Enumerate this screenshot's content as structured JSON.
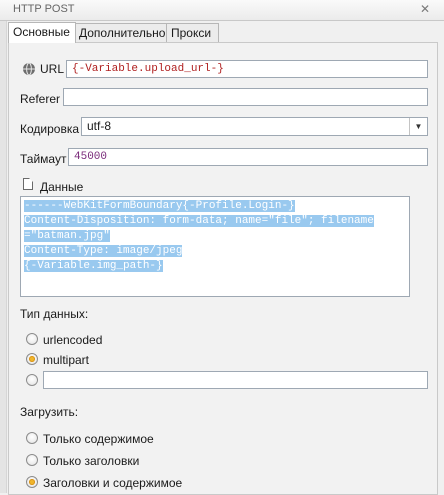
{
  "window": {
    "title": "HTTP POST"
  },
  "tabs": [
    {
      "label": "Основные",
      "active": true
    },
    {
      "label": "Дополнительно",
      "active": false
    },
    {
      "label": "Прокси",
      "active": false
    }
  ],
  "fields": {
    "url": {
      "label": "URL",
      "value": "{-Variable.upload_url-}"
    },
    "referer": {
      "label": "Referer",
      "value": ""
    },
    "encoding": {
      "label": "Кодировка",
      "value": "utf-8"
    },
    "timeout": {
      "label": "Таймаут",
      "value": "45000"
    }
  },
  "data_section": {
    "label": "Данные",
    "lines": [
      "------WebKitFormBoundary{-Profile.Login-}",
      "Content-Disposition: form-data; name=\"file\"; filename",
      "=\"batman.jpg\"",
      "Content-Type: image/jpeg",
      "{-Variable.img_path-}"
    ]
  },
  "data_type": {
    "label": "Тип данных:",
    "options": [
      {
        "label": "urlencoded",
        "checked": false
      },
      {
        "label": "multipart",
        "checked": true
      },
      {
        "label": "",
        "checked": false
      }
    ]
  },
  "load": {
    "label": "Загрузить:",
    "options": [
      {
        "label": "Только содержимое",
        "checked": false
      },
      {
        "label": "Только заголовки",
        "checked": false
      },
      {
        "label": "Заголовки и содержимое",
        "checked": true
      }
    ]
  },
  "colors": {
    "selection": "#99c9ef",
    "accent_var": "#b02020",
    "radio_selected": "#f0b62c"
  },
  "icons": {
    "close": "close-icon",
    "url": "globe-icon",
    "data": "document-icon"
  }
}
